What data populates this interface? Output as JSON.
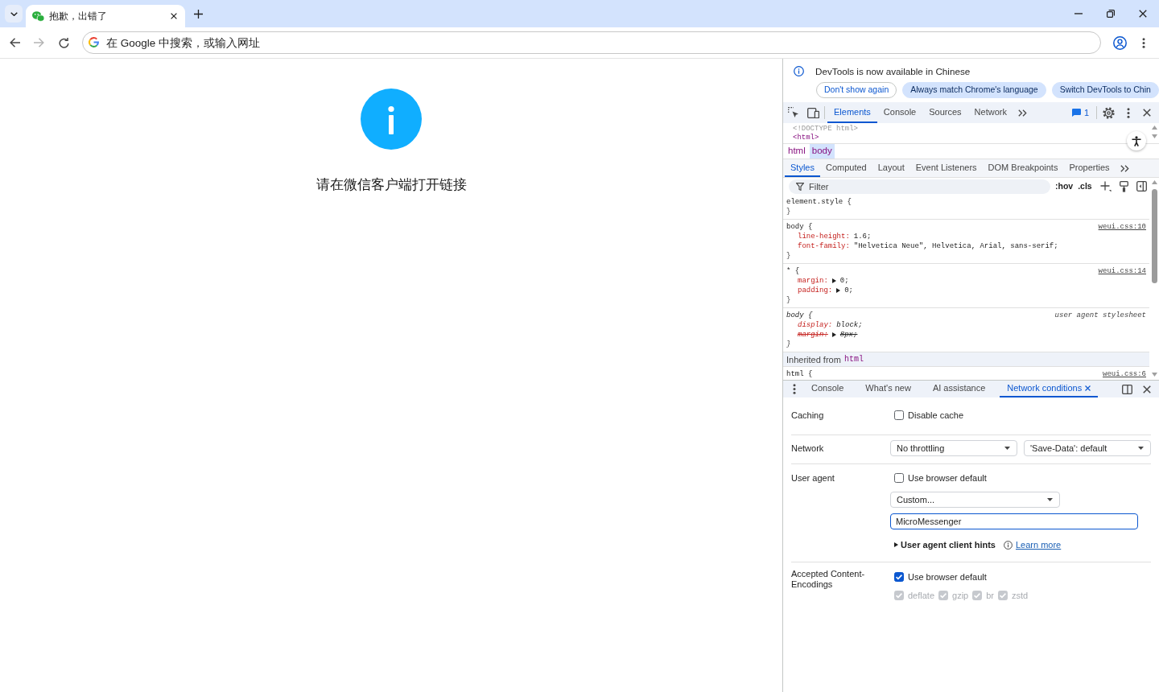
{
  "browser": {
    "tabs": [
      {
        "title": "抱歉，出错了",
        "selected": true
      }
    ],
    "nav_buttons": [
      {
        "kind": "back",
        "disabled": false
      },
      {
        "kind": "forward",
        "disabled": true
      },
      {
        "kind": "reload",
        "disabled": false
      }
    ],
    "address_bar": {
      "placeholder": "在 Google 中搜索，或输入网址"
    }
  },
  "page": {
    "message": "请在微信客户端打开链接"
  },
  "devtools": {
    "infobar": {
      "message": "DevTools is now available in Chinese",
      "buttons": [
        {
          "label": "Don't show again",
          "kind": "outline"
        },
        {
          "label": "Always match Chrome's language",
          "kind": "filled"
        },
        {
          "label": "Switch DevTools to Chin",
          "kind": "filled"
        }
      ]
    },
    "main_tabs": [
      {
        "label": "Elements",
        "selected": true
      },
      {
        "label": "Console",
        "selected": false
      },
      {
        "label": "Sources",
        "selected": false
      },
      {
        "label": "Network",
        "selected": false
      }
    ],
    "issues_count": "1",
    "dom_tree": [
      {
        "text": "<!DOCTYPE html>",
        "kind": "doctype"
      },
      {
        "text": "<html>",
        "kind": "tag"
      }
    ],
    "breadcrumbs": [
      {
        "label": "html",
        "selected": false
      },
      {
        "label": "body",
        "selected": true
      }
    ],
    "sidebar_tabs": [
      {
        "label": "Styles",
        "selected": true
      },
      {
        "label": "Computed",
        "selected": false
      },
      {
        "label": "Layout",
        "selected": false
      },
      {
        "label": "Event Listeners",
        "selected": false
      },
      {
        "label": "DOM Breakpoints",
        "selected": false
      },
      {
        "label": "Properties",
        "selected": false
      }
    ],
    "filter": {
      "placeholder": "Filter",
      "toggles": [
        ":hov",
        ".cls"
      ]
    },
    "style_pane": [
      {
        "kind": "rule",
        "selector": "element.style {",
        "user_agent": false,
        "close": "}"
      },
      {
        "kind": "rule",
        "selector": "body {",
        "source": "weui.css:10",
        "user_agent": false,
        "properties": [
          {
            "name": "line-height:",
            "value": "1.6;",
            "expandable": false,
            "overridden": false
          },
          {
            "name": "font-family:",
            "value": "\"Helvetica Neue\", Helvetica, Arial, sans-serif;",
            "expandable": false,
            "overridden": false
          }
        ],
        "close": "}"
      },
      {
        "kind": "rule",
        "selector": "* {",
        "source": "weui.css:14",
        "user_agent": false,
        "properties": [
          {
            "name": "margin:",
            "value": "0;",
            "expandable": true,
            "overridden": false
          },
          {
            "name": "padding:",
            "value": "0;",
            "expandable": true,
            "overridden": false
          }
        ],
        "close": "}"
      },
      {
        "kind": "rule",
        "selector": "body {",
        "source": "user agent stylesheet",
        "user_agent": true,
        "properties": [
          {
            "name": "display:",
            "value": "block;",
            "expandable": false,
            "overridden": false
          },
          {
            "name": "margin:",
            "value": "8px;",
            "expandable": true,
            "overridden": true
          }
        ],
        "close": "}"
      },
      {
        "kind": "inherited",
        "label": "Inherited from",
        "element": "html"
      },
      {
        "kind": "rule",
        "selector": "html {",
        "source": "weui.css:6",
        "user_agent": false
      }
    ],
    "drawer": {
      "tabs": [
        {
          "label": "Console",
          "selected": false,
          "closable": false
        },
        {
          "label": "What's new",
          "selected": false,
          "closable": false
        },
        {
          "label": "AI assistance",
          "selected": false,
          "closable": false
        },
        {
          "label": "Network conditions",
          "selected": true,
          "closable": true
        }
      ],
      "network_conditions": {
        "caching": {
          "label": "Caching",
          "checkbox": {
            "label": "Disable cache",
            "checked": false
          }
        },
        "network": {
          "label": "Network",
          "throttling": "No throttling",
          "save_data": "'Save-Data': default"
        },
        "user_agent": {
          "label": "User agent",
          "checkbox": {
            "label": "Use browser default",
            "checked": false
          },
          "preset": "Custom...",
          "value": "MicroMessenger",
          "focused": true,
          "client_hints": {
            "label": "User agent client hints",
            "expanded": false,
            "link": "Learn more"
          }
        },
        "encodings": {
          "label": "Accepted Content-Encodings",
          "checkbox": {
            "label": "Use browser default",
            "checked": true
          },
          "options": [
            {
              "label": "deflate",
              "checked": true,
              "disabled": true
            },
            {
              "label": "gzip",
              "checked": true,
              "disabled": true
            },
            {
              "label": "br",
              "checked": true,
              "disabled": true
            },
            {
              "label": "zstd",
              "checked": true,
              "disabled": true
            }
          ]
        }
      }
    }
  }
}
